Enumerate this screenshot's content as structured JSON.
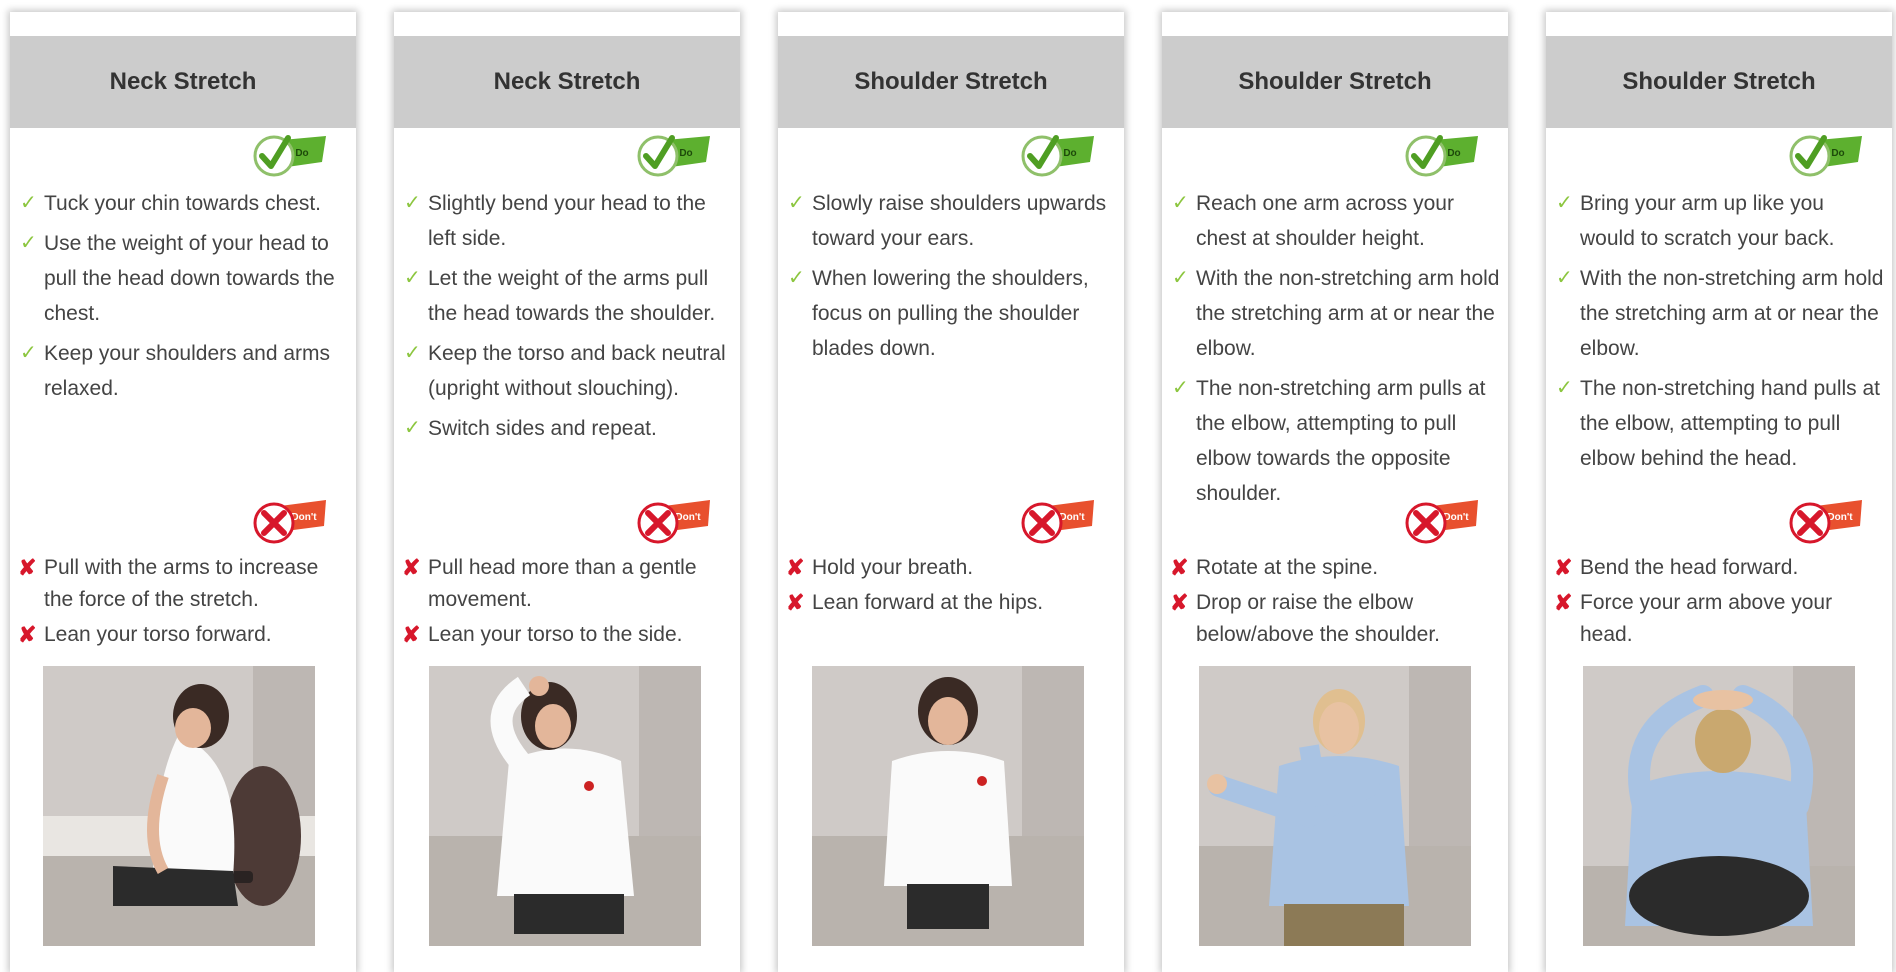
{
  "badges": {
    "do_label": "Do",
    "dont_label": "Don't"
  },
  "colors": {
    "header_bg": "#cccccc",
    "check": "#8cc63f",
    "cross": "#d7172b",
    "do_badge": "#5db02f",
    "dont_badge": "#e8502e"
  },
  "cards": [
    {
      "title": "Neck Stretch",
      "do": [
        "Tuck your chin towards chest.",
        "Use the weight of your head to pull the head down towards the chest.",
        "Keep your shoulders and arms relaxed."
      ],
      "dont": [
        "Pull with the arms to increase the force of the stretch.",
        "Lean your torso forward."
      ],
      "photo": "woman-seated-chin-to-chest"
    },
    {
      "title": "Neck Stretch",
      "do": [
        "Slightly bend your head to the left side.",
        "Let the weight of the arms pull the head towards the shoulder.",
        "Keep the torso and back neutral (upright without slouching).",
        "Switch sides and repeat."
      ],
      "dont": [
        "Pull head more than a gentle movement.",
        "Lean your torso to the side."
      ],
      "photo": "woman-seated-head-tilt"
    },
    {
      "title": "Shoulder Stretch",
      "do": [
        "Slowly raise shoulders upwards toward your ears.",
        "When lowering the shoulders, focus on pulling the shoulder blades down."
      ],
      "dont": [
        "Hold your breath.",
        "Lean forward at the hips."
      ],
      "photo": "woman-seated-shoulder-raise"
    },
    {
      "title": "Shoulder Stretch",
      "do": [
        "Reach one arm across your chest at shoulder height.",
        "With the non-stretching arm hold the stretching arm at or near the elbow.",
        "The non-stretching arm pulls at the elbow, attempting to pull elbow towards the opposite shoulder."
      ],
      "dont": [
        "Rotate at the spine.",
        "Drop or raise the elbow below/above the shoulder."
      ],
      "photo": "man-seated-cross-body-arm"
    },
    {
      "title": "Shoulder Stretch",
      "do": [
        "Bring your arm up like you would to scratch your back.",
        "With the non-stretching arm hold the stretching arm at or near the elbow.",
        "The non-stretching hand pulls at the elbow, attempting to pull elbow behind the head."
      ],
      "dont": [
        "Bend the head forward.",
        "Force your arm above your head."
      ],
      "photo": "man-seated-overhead-triceps"
    }
  ]
}
